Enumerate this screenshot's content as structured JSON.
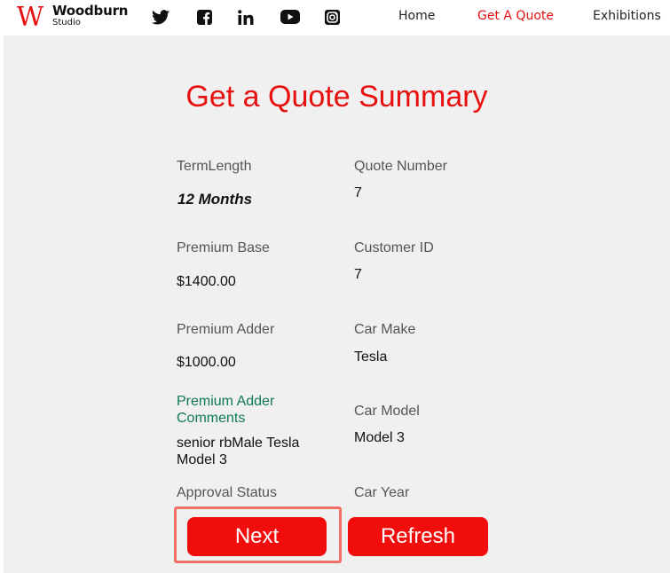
{
  "brand": {
    "logo_letter": "W",
    "name": "Woodburn",
    "subtitle": "Studio"
  },
  "social_icons": [
    "twitter-icon",
    "facebook-icon",
    "linkedin-icon",
    "youtube-icon",
    "instagram-icon"
  ],
  "nav": {
    "home": "Home",
    "quote": "Get A Quote",
    "exhibitions": "Exhibitions",
    "active": "Get A Quote"
  },
  "colors": {
    "accent": "#e8100f",
    "panel_bg": "#f0f0f0",
    "label": "#555555",
    "green_label": "#0f7a52",
    "highlight": "#f07067"
  },
  "page": {
    "title": "Get a Quote Summary"
  },
  "fields": {
    "term_length": {
      "label": "TermLength",
      "value": "12 Months"
    },
    "quote_number": {
      "label": "Quote Number",
      "value": "7"
    },
    "premium_base": {
      "label": "Premium Base",
      "value": "$1400.00"
    },
    "customer_id": {
      "label": "Customer ID",
      "value": "7"
    },
    "premium_adder": {
      "label": "Premium Adder",
      "value": "$1000.00"
    },
    "car_make": {
      "label": "Car Make",
      "value": "Tesla"
    },
    "premium_adder_comments": {
      "label": "Premium Adder Comments",
      "value": "senior rbMale Tesla Model 3"
    },
    "car_model": {
      "label": "Car Model",
      "value": "Model 3"
    },
    "approval_status": {
      "label": "Approval Status"
    },
    "car_year": {
      "label": "Car Year"
    }
  },
  "buttons": {
    "next": "Next",
    "refresh": "Refresh"
  }
}
